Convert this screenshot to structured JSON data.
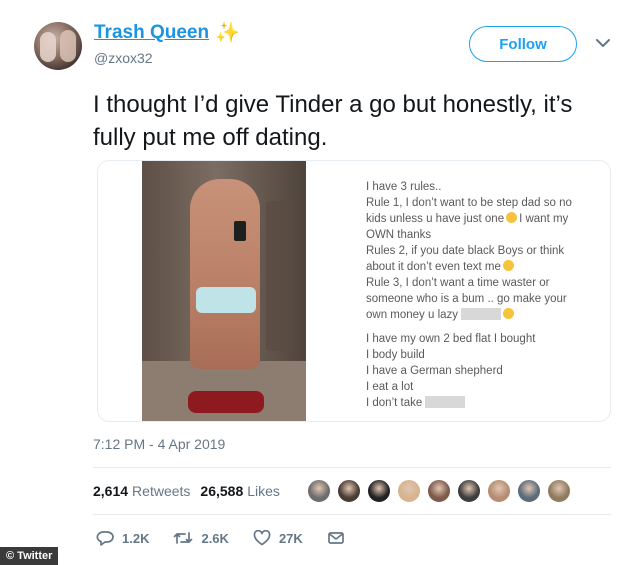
{
  "author": {
    "display_name": "Trash Queen",
    "handle": "@zxox32",
    "name_emoji": "sparkles-icon"
  },
  "follow_button": {
    "label": "Follow"
  },
  "tweet": {
    "text": "I thought I’d give Tinder a go but honestly, it’s fully put me off dating."
  },
  "media_text": {
    "lines": [
      "I have 3 rules..",
      "Rule 1, I don’t want to be step dad so no",
      "kids unless u have just one",
      "I want my",
      "OWN thanks",
      "Rules 2, if you date black Boys or think",
      "about it don’t even text me",
      "Rule 3, I don’t want a time waster or",
      "someone who is a bum .. go make your",
      "own money u lazy",
      "I have my own 2 bed flat I bought",
      "I body build",
      "I have a German shepherd",
      "I eat a lot",
      "I don’t take"
    ]
  },
  "timestamp": "7:12 PM - 4 Apr 2019",
  "stats": {
    "retweets_count": "2,614",
    "retweets_label": "Retweets",
    "likes_count": "26,588",
    "likes_label": "Likes"
  },
  "likers": [
    {
      "color": "#6d6d6d"
    },
    {
      "color": "#4a3b35"
    },
    {
      "color": "#222222"
    },
    {
      "color": "#d7b38e"
    },
    {
      "color": "#7c5a4c"
    },
    {
      "color": "#3d3d3d"
    },
    {
      "color": "#b58d73"
    },
    {
      "color": "#5a6b7a"
    },
    {
      "color": "#8f7b60"
    }
  ],
  "actions": {
    "reply_count": "1.2K",
    "retweet_count": "2.6K",
    "like_count": "27K"
  },
  "watermark": "© Twitter",
  "colors": {
    "accent": "#1da1f2",
    "name": "#1b95e0",
    "muted": "#657786"
  }
}
